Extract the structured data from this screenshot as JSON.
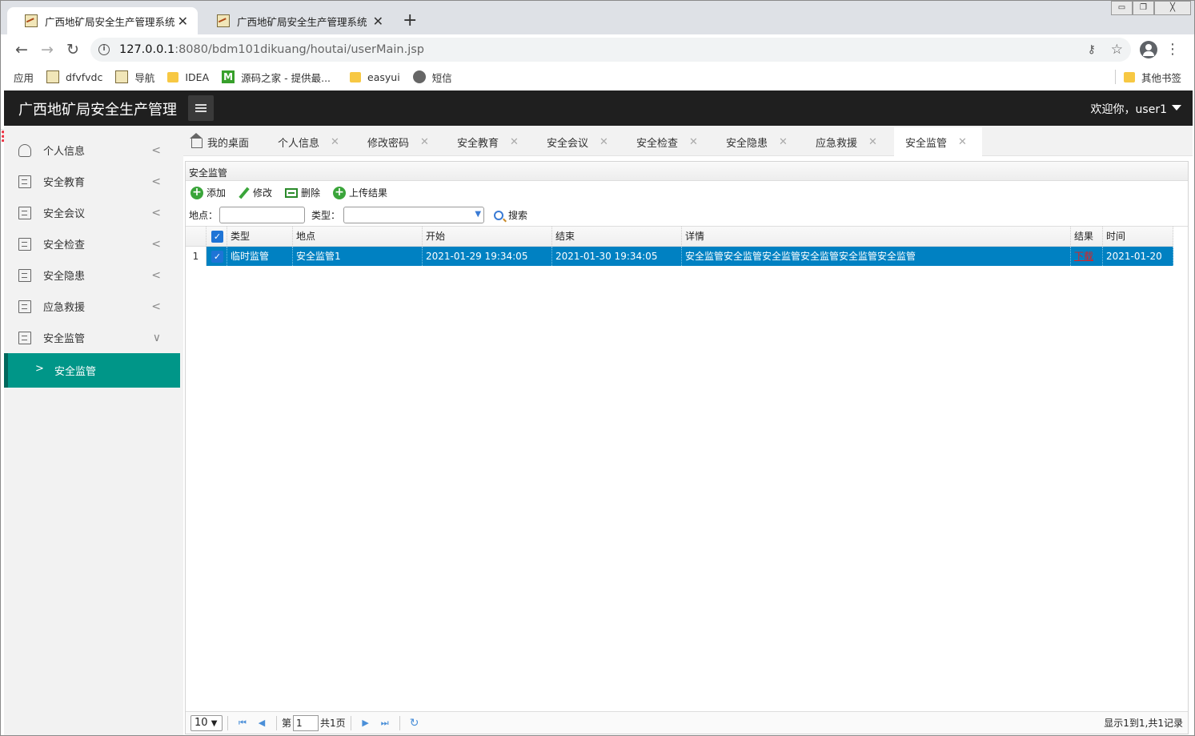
{
  "browser": {
    "tabs": [
      {
        "title": "广西地矿局安全生产管理系统",
        "close": "✕"
      },
      {
        "title": "广西地矿局安全生产管理系统",
        "close": "✕"
      }
    ],
    "new_tab": "+",
    "url_host": "127.0.0.1",
    "url_rest": ":8080/bdm101dikuang/houtai/userMain.jsp",
    "bookmarks": [
      {
        "label": "应用",
        "icon": "apps-grid-icon"
      },
      {
        "label": "dfvfvdc",
        "icon": "image-icon"
      },
      {
        "label": "导航",
        "icon": "image-icon"
      },
      {
        "label": "IDEA",
        "icon": "folder-icon"
      },
      {
        "label": "源码之家 - 提供最...",
        "icon": "m-logo-icon"
      },
      {
        "label": "easyui",
        "icon": "folder-icon"
      },
      {
        "label": "短信",
        "icon": "globe-icon"
      }
    ],
    "other_bookmarks": "其他书签"
  },
  "app": {
    "title": "广西地矿局安全生产管理",
    "welcome": "欢迎你，user1"
  },
  "sidebar": {
    "items": [
      {
        "label": "个人信息",
        "icon": "user-icon",
        "chevron": "<"
      },
      {
        "label": "安全教育",
        "icon": "document-icon",
        "chevron": "<"
      },
      {
        "label": "安全会议",
        "icon": "document-icon",
        "chevron": "<"
      },
      {
        "label": "安全检查",
        "icon": "document-icon",
        "chevron": "<"
      },
      {
        "label": "安全隐患",
        "icon": "document-icon",
        "chevron": "<"
      },
      {
        "label": "应急救援",
        "icon": "document-icon",
        "chevron": "<"
      },
      {
        "label": "安全监管",
        "icon": "document-icon",
        "chevron": "∨"
      }
    ],
    "sub_active": {
      "arrow": ">",
      "label": "安全监管"
    }
  },
  "tabs": [
    {
      "label": "我的桌面"
    },
    {
      "label": "个人信息",
      "close": "✕"
    },
    {
      "label": "修改密码",
      "close": "✕"
    },
    {
      "label": "安全教育",
      "close": "✕"
    },
    {
      "label": "安全会议",
      "close": "✕"
    },
    {
      "label": "安全检查",
      "close": "✕"
    },
    {
      "label": "安全隐患",
      "close": "✕"
    },
    {
      "label": "应急救援",
      "close": "✕"
    },
    {
      "label": "安全监管",
      "close": "✕"
    }
  ],
  "panel": {
    "title": "安全监管",
    "toolbar": {
      "add": "添加",
      "edit": "修改",
      "delete": "删除",
      "upload": "上传结果"
    },
    "search": {
      "location_label": "地点：",
      "location_value": "",
      "type_label": "类型：",
      "type_value": "",
      "search_label": "搜索"
    },
    "grid": {
      "columns": [
        "类型",
        "地点",
        "开始",
        "结束",
        "详情",
        "结果",
        "时间"
      ],
      "rows": [
        {
          "rownum": "1",
          "checked": "✓",
          "type": "临时监管",
          "location": "安全监管1",
          "start": "2021-01-29 19:34:05",
          "end": "2021-01-30 19:34:05",
          "detail": "安全监管安全监管安全监管安全监管安全监管安全监管",
          "result": "下载",
          "time": "2021-01-20"
        }
      ],
      "header_check": "✓"
    },
    "pager": {
      "page_size": "10",
      "page_prefix": "第",
      "page_value": "1",
      "page_total": "共1页",
      "info": "显示1到1,共1记录"
    }
  },
  "colors": {
    "header_bg": "#1f1f1f",
    "sidebar_active": "#009688",
    "row_selected": "#0081c2",
    "download_link": "#e02020"
  }
}
